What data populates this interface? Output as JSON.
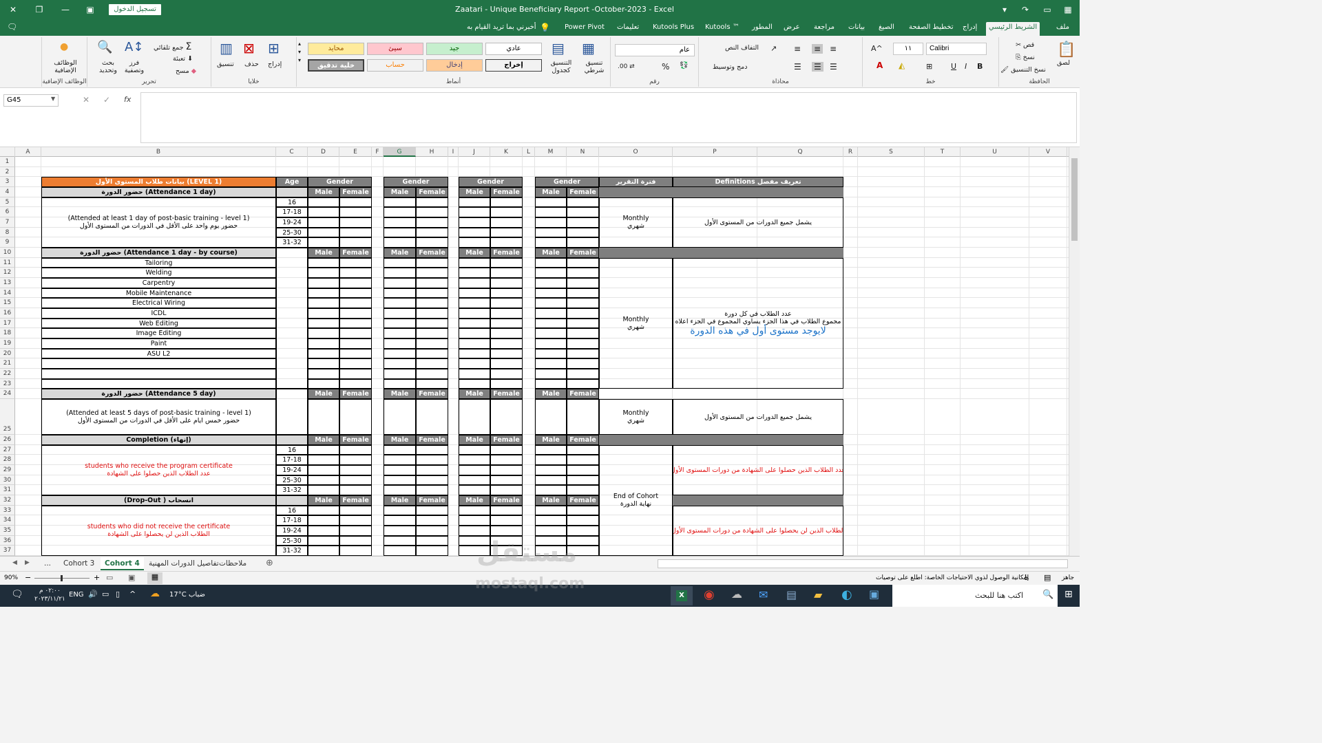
{
  "window": {
    "title": "Zaatari - Unique Beneficiary Report -October-2023  -  Excel",
    "signin": "تسجيل الدخول"
  },
  "tabs": [
    "ملف",
    "الشريط الرئيسي",
    "إدراج",
    "تخطيط الصفحة",
    "الصيغ",
    "بيانات",
    "مراجعة",
    "عرض",
    "المطور",
    "Kutools ™",
    "Kutools Plus",
    "تعليمات",
    "Power Pivot",
    "أخبرني بما تريد القيام به"
  ],
  "ribbon": {
    "clipboard": {
      "label": "الحافظة",
      "paste": "لصق",
      "cut": "قص",
      "copy": "نسخ",
      "format_painter": "نسخ التنسيق"
    },
    "font": {
      "label": "خط",
      "name": "Calibri",
      "size": "١١",
      "bold": "B",
      "italic": "I",
      "underline": "U"
    },
    "alignment": {
      "label": "محاذاة",
      "wrap": "التفاف النص",
      "merge": "دمج وتوسيط"
    },
    "number": {
      "label": "رقم",
      "format": "عام",
      "percent": "%"
    },
    "styles": {
      "label": "أنماط",
      "conditional": "تنسيق شرطي",
      "as_table": "التنسيق كجدول",
      "normal": "عادي",
      "bad": "سيئ",
      "good": "جيد",
      "neutral": "محايد",
      "output": "إخراج",
      "input": "إدخال",
      "calculation": "حساب",
      "check": "خلية تدقيق"
    },
    "cells": {
      "label": "خلايا",
      "insert": "إدراج",
      "delete": "حذف",
      "format": "تنسيق"
    },
    "editing": {
      "label": "تحرير",
      "autosum": "جمع تلقائي",
      "fill": "تعبئة",
      "clear": "مسح",
      "sort": "فرز وتصفية",
      "find": "بحث وتحديد"
    },
    "addins": {
      "label": "الوظائف الإضافية",
      "addins": "الوظائف الإضافية"
    }
  },
  "formula": {
    "namebox": "G45",
    "fx": "fx"
  },
  "columns": [
    "A",
    "B",
    "C",
    "D",
    "E",
    "F",
    "G",
    "H",
    "I",
    "J",
    "K",
    "L",
    "M",
    "N",
    "O",
    "P",
    "Q",
    "R",
    "S",
    "T",
    "U",
    "V"
  ],
  "rows": [
    "1",
    "2",
    "3",
    "4",
    "5",
    "6",
    "7",
    "8",
    "9",
    "10",
    "11",
    "12",
    "13",
    "14",
    "15",
    "16",
    "17",
    "18",
    "19",
    "20",
    "21",
    "22",
    "23",
    "24",
    "25",
    "26",
    "27",
    "28",
    "29",
    "30",
    "31",
    "32",
    "33",
    "34",
    "35",
    "36",
    "37"
  ],
  "sheet": {
    "main_header": "بيانات طلاب المستوى الأول (LEVEL 1)",
    "age": "Age",
    "gender": "Gender",
    "male": "Male",
    "female": "Female",
    "period_header": "فترة التقرير",
    "definitions_header": "Definitions تعريف مفصل",
    "attendance1": "حضور الدورة   (Attendance 1 day)",
    "attendance1_en": "(Attended at least 1 day of post-basic training - level 1)",
    "attendance1_ar": "حضور يوم واحد على الأقل في الدورات من المستوى الأول",
    "attendance1_course": "حضور الدورة   (Attendance 1 day - by course)",
    "courses": [
      "Tailoring",
      "Welding",
      "Carpentry",
      "Mobile Maintenance",
      "Electrical Wiring",
      "ICDL",
      "Web Editing",
      "Image Editing",
      "Paint",
      "ASU L2"
    ],
    "ages": [
      "16",
      "17-18",
      "19-24",
      "25-30",
      "31-32"
    ],
    "attendance5": "حضور الدورة   (Attendance 5 day)",
    "attendance5_en": "(Attended at least 5 days of post-basic training - level 1)",
    "attendance5_ar": "حضور خمس ايام على الأقل في الدورات من المستوى الأول",
    "completion": "Completion (إنهاء)",
    "completion_en": "students who receive the program certificate",
    "completion_ar": "عدد الطلاب الذين حصلوا على الشهادة",
    "dropout": "(Drop-Out ) انسحاب",
    "dropout_en": "students who did not receive the certificate",
    "dropout_ar": "الطلاب الذين لن يحصلوا على الشهادة",
    "monthly": "Monthly",
    "monthly_ar": "شهري",
    "end_cohort": "End of Cohort",
    "end_cohort_ar": "نهاية الدورة",
    "def1": "يشمل جميع الدورات من المستوى الأول",
    "def2a": "عدد الطلاب في كل دورة",
    "def2b": "مجموع الطلاب في هذا الجزء يساوي المجموع في الجزء اعلاه",
    "def2c": "لايوجد مستوى أول في هذه الدورة",
    "def3": "يشمل جميع الدورات من المستوى الأول",
    "def4": "عدد الطلاب الذين حصلوا على الشهادة من دورات المستوى الأول",
    "def5": "الطلاب الذين لن يحصلوا على الشهادة من دورات المستوى الأول"
  },
  "sheettabs": [
    "...",
    "Cohort 3",
    "Cohort 4",
    "تفاصيل الدورات المهنية",
    "ملاحظات"
  ],
  "status": {
    "ready": "جاهز",
    "accessibility": "إمكانية الوصول لذوي الاحتياجات الخاصة: اطلع على توصيات",
    "zoom": "90%"
  },
  "taskbar": {
    "search": "اكتب هنا للبحث",
    "weather": "ضباب",
    "temp": "17°C",
    "lang": "ENG",
    "time": "٠٢:٠٠ م",
    "date": "٢٠٢٣/١١/٢١"
  },
  "watermark": {
    "ar": "مستقل",
    "en": "mostaql.com"
  }
}
